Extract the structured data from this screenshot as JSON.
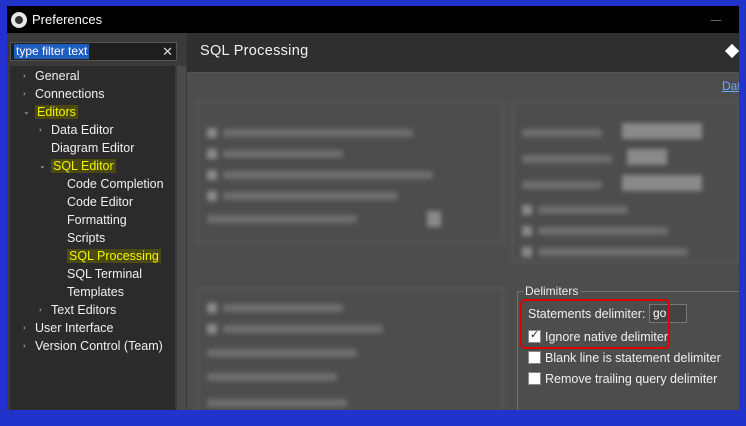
{
  "window": {
    "title": "Preferences"
  },
  "filter": {
    "text": "type filter text",
    "clear": "✕"
  },
  "tree": [
    {
      "label": "General",
      "highlight": false
    },
    {
      "label": "Connections",
      "highlight": false
    },
    {
      "label": "Editors",
      "highlight": true
    },
    {
      "label": "Data Editor",
      "highlight": false
    },
    {
      "label": "Diagram Editor",
      "highlight": false
    },
    {
      "label": "SQL Editor",
      "highlight": true
    },
    {
      "label": "Code Completion",
      "highlight": false
    },
    {
      "label": "Code Editor",
      "highlight": false
    },
    {
      "label": "Formatting",
      "highlight": false
    },
    {
      "label": "Scripts",
      "highlight": false
    },
    {
      "label": "SQL Processing",
      "highlight": true
    },
    {
      "label": "SQL Terminal",
      "highlight": false
    },
    {
      "label": "Templates",
      "highlight": false
    },
    {
      "label": "Text Editors",
      "highlight": false
    },
    {
      "label": "User Interface",
      "highlight": false
    },
    {
      "label": "Version Control (Team)",
      "highlight": false
    }
  ],
  "main": {
    "title": "SQL Processing",
    "link": "Dat"
  },
  "delimiters": {
    "legend": "Delimiters",
    "statements_label": "Statements delimiter:",
    "statements_value": "go",
    "ignore_native": {
      "label": "Ignore native delimiter",
      "checked": true
    },
    "blank_line": {
      "label": "Blank line is statement delimiter",
      "checked": false
    },
    "remove_trailing": {
      "label": "Remove trailing query delimiter",
      "checked": false
    }
  },
  "colors": {
    "highlight_text": "#f4f400",
    "annotation": "#e00000",
    "frame": "#2233cc"
  }
}
